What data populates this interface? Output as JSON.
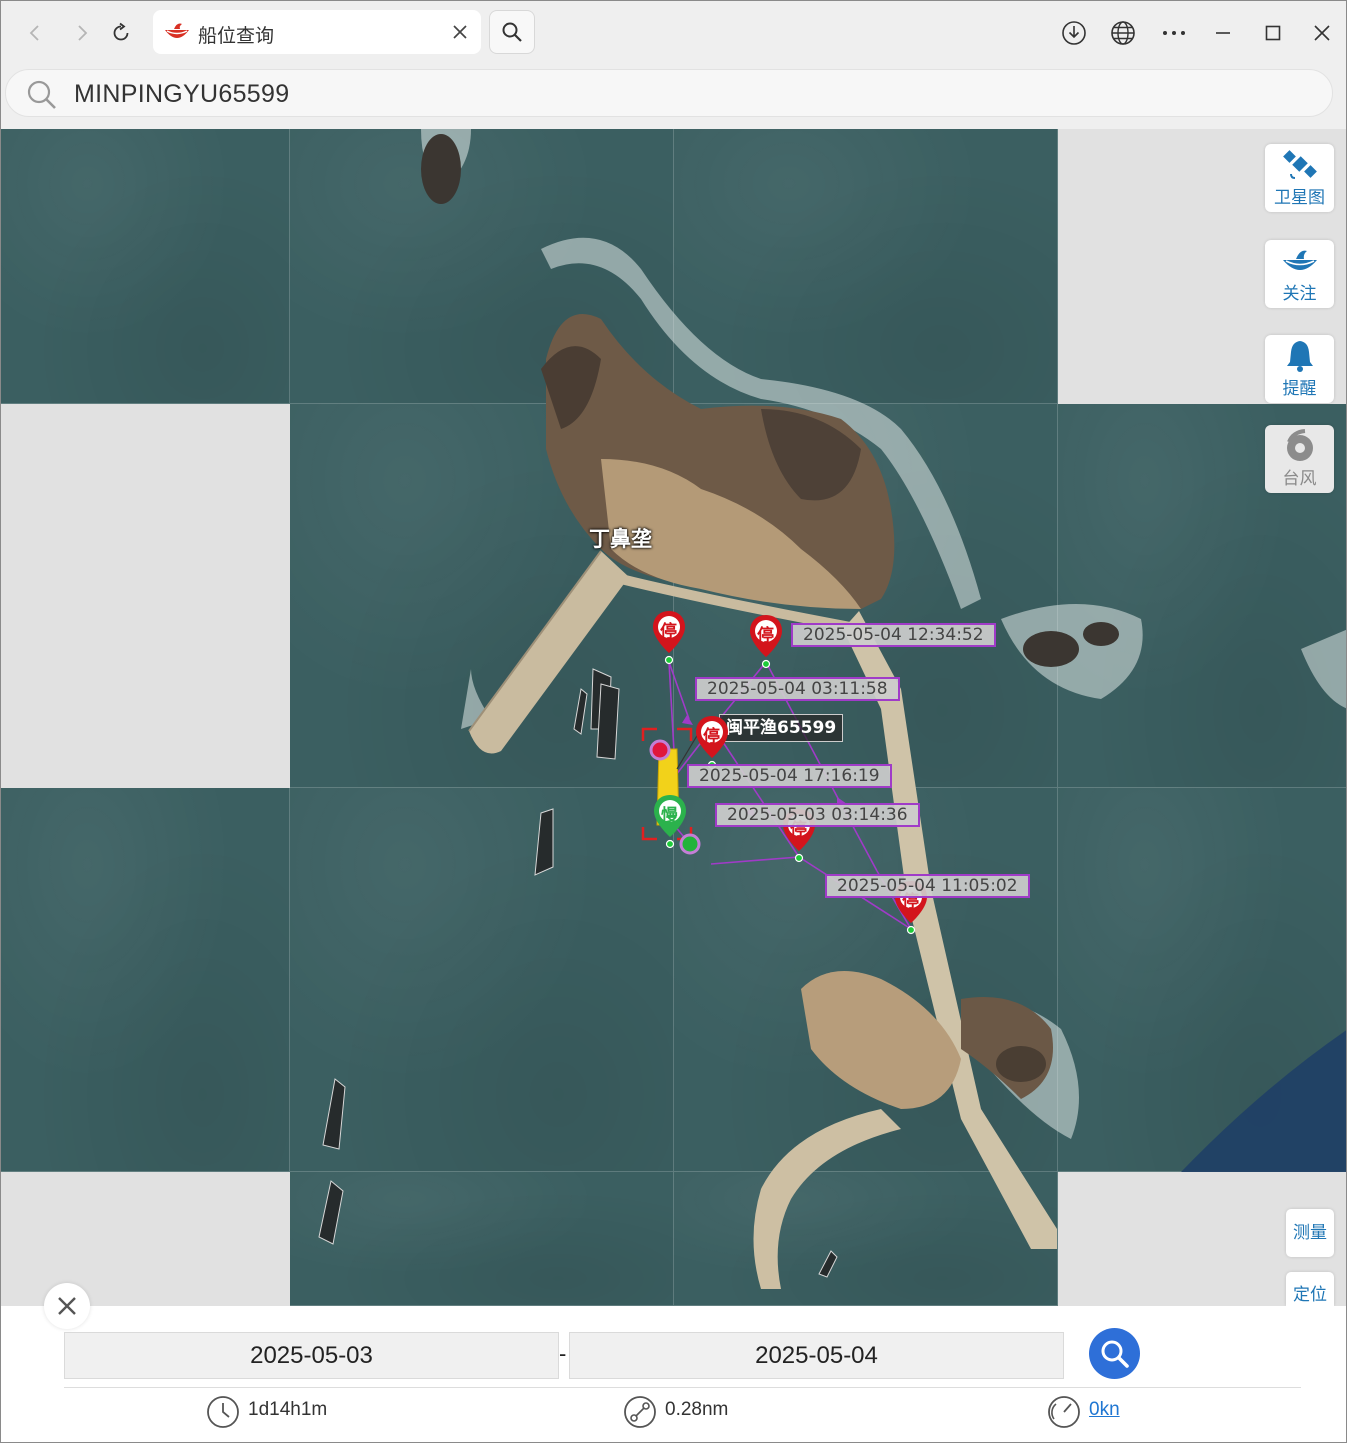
{
  "browser": {
    "tab_title": "船位查询",
    "address_text": "MINPINGYU65599"
  },
  "map": {
    "place_label": "丁鼻垄",
    "ship_label": "闽平渔65599",
    "time_labels": [
      "2025-05-04 12:34:52",
      "2025-05-04 03:11:58",
      "2025-05-04 17:16:19",
      "2025-05-03 03:14:36",
      "2025-05-04 11:05:02"
    ],
    "stop_marker_text": "停",
    "slow_marker_text": "慢",
    "side_buttons": {
      "satellite": "卫星图",
      "follow": "关注",
      "alert": "提醒",
      "typhoon": "台风",
      "measure": "测量",
      "locate": "定位"
    },
    "colors": {
      "sea": "#3b5f61",
      "stop_marker": "#d3141c",
      "slow_marker": "#2bb24c",
      "track": "#a03bc8",
      "button_text": "#1f76b5"
    }
  },
  "panel": {
    "start_date": "2025-05-03",
    "separator": "-",
    "end_date": "2025-05-04",
    "duration": "1d14h1m",
    "distance": "0.28nm",
    "speed": "0kn"
  }
}
